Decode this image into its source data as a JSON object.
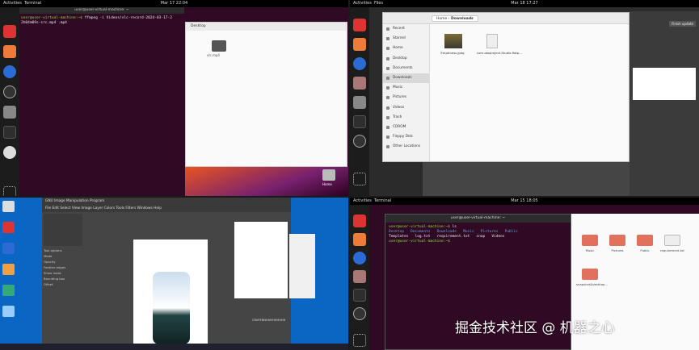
{
  "top_left": {
    "topbar": {
      "activities": "Activities",
      "app": "Terminal",
      "clock": "Mar 17 22:04"
    },
    "terminal": {
      "title": "user@user-virtual-machine: ~",
      "prompt": "user@user-virtual-machine:~$",
      "command": " ffmpeg -i Videos/vlc-record-2024-03-17-2",
      "line2": "2h04m09s-src.mp4 .mp4"
    },
    "file_window": {
      "title": "Desktop",
      "file_label": "vlc.mp4"
    },
    "desktop_item": "Home"
  },
  "top_right": {
    "topbar": {
      "activities": "Activities",
      "app": "Files",
      "clock": "Mar 18 17:27"
    },
    "files": {
      "path_home": "Home",
      "path_current": "Downloads",
      "sidebar": [
        "Recent",
        "Starred",
        "Home",
        "Desktop",
        "Documents",
        "Downloads",
        "Music",
        "Pictures",
        "Videos",
        "Trash",
        "CDROM",
        "Floppy Disk",
        "Other Locations"
      ],
      "selected": "Downloads",
      "items": [
        {
          "name": "Emptiness.jpeg"
        },
        {
          "name": "com.obsproject.Studio.flatp..."
        }
      ]
    },
    "gimp_panel": {
      "label": "Finish update"
    }
  },
  "bottom_left": {
    "gimp": {
      "title": "GNU Image Manipulation Program",
      "menu": [
        "File",
        "Edit",
        "Select",
        "View",
        "Image",
        "Layer",
        "Colors",
        "Tools",
        "Filters",
        "Windows",
        "Help"
      ],
      "options": [
        "Tool options",
        "Mode",
        "Opacity",
        "Feather edges",
        "Show mask",
        "Bounding box",
        "Offset"
      ],
      "layer_label": "CRVRFBNHHHHHHHHH"
    }
  },
  "bottom_right": {
    "topbar": {
      "activities": "Activities",
      "app": "Terminal",
      "clock": "Mar 15 18:05"
    },
    "terminal": {
      "title": "user@user-virtual-machine: ~",
      "prompt": "user@user-virtual-machine:~$",
      "cmd": " ls",
      "row1": [
        "Desktop",
        "Documents",
        "Downloads",
        "Music",
        "Pictures",
        "Public"
      ],
      "row2": [
        "Templates",
        "log.txt",
        "requirement.txt",
        "snap",
        "Videos"
      ],
      "last_prompt": "user@user-virtual-machine:~$"
    },
    "files": {
      "folders": [
        "Music",
        "Pictures",
        "Public",
        "requirement.txt",
        "snapshot&desktop..."
      ]
    }
  },
  "watermark": "掘金技术社区 @ 机器之心"
}
